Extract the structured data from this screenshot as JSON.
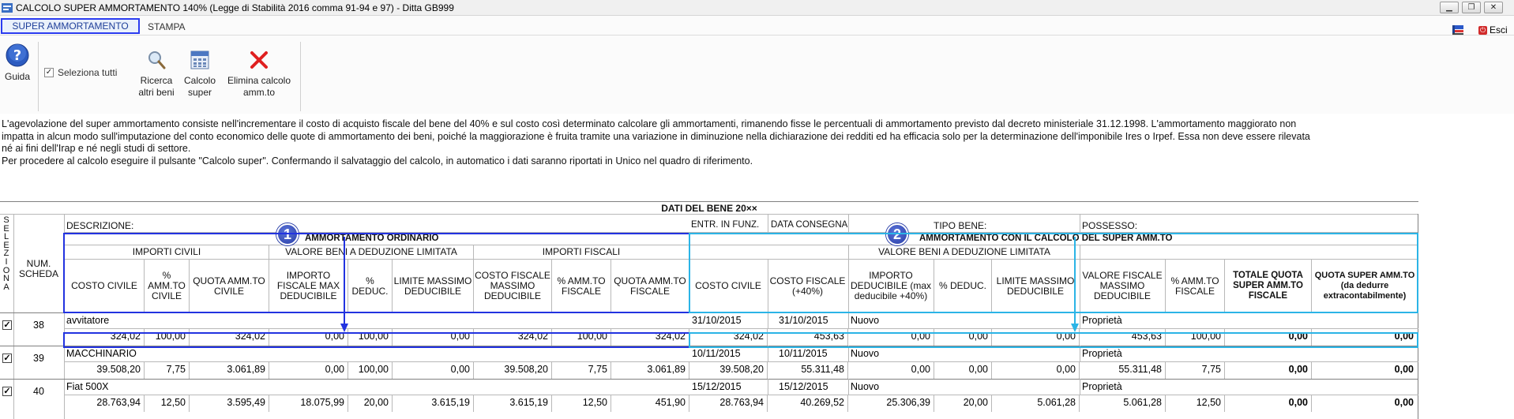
{
  "window": {
    "title": "CALCOLO SUPER AMMORTAMENTO 140% (Legge di Stabilità 2016 comma 91-94 e 97) - Ditta GB999"
  },
  "tabs": {
    "super": "SUPER AMMORTAMENTO",
    "stampa": "STAMPA",
    "esci": "Esci"
  },
  "toolbar": {
    "guida": "Guida",
    "seleziona_tutti": "Seleziona tutti",
    "ricerca_l1": "Ricerca",
    "ricerca_l2": "altri beni",
    "calcolo_l1": "Calcolo",
    "calcolo_l2": "super",
    "elimina_l1": "Elimina calcolo",
    "elimina_l2": "amm.to"
  },
  "description": {
    "line1": "L'agevolazione del super ammortamento consiste nell'incrementare il costo di acquisto fiscale del bene del 40% e sul costo così determinato calcolare gli ammortamenti, rimanendo fisse le percentuali di ammortamento previsto dal decreto ministeriale 31.12.1998. L'ammortamento maggiorato non",
    "line2": "impatta in alcun modo sull'imputazione del conto economico delle quote di ammortamento dei beni, poiché la maggiorazione è fruita tramite una variazione in diminuzione nella dichiarazione dei redditi ed ha efficacia solo per la determinazione dell'imponibile Ires o Irpef. Essa non deve essere rilevata",
    "line3": "né ai fini dell'Irap e né negli studi di settore.",
    "line4": "Per procedere al calcolo eseguire il pulsante \"Calcolo super\". Confermando il salvataggio del calcolo, in automatico i dati saranno riportati in Unico nel quadro di riferimento."
  },
  "grid": {
    "title": "DATI DEL BENE 20××",
    "seleziona": "S E L E Z I O N A",
    "num_scheda": "NUM. SCHEDA",
    "descrizione": "DESCRIZIONE:",
    "entr_in_funz": "ENTR. IN FUNZ.",
    "data_consegna": "DATA CONSEGNA",
    "tipo_bene": "TIPO BENE:",
    "possesso": "POSSESSO:",
    "amm_ordinario": "AMMORTAMENTO ORDINARIO",
    "amm_super": "AMMORTAMENTO CON IL CALCOLO DEL SUPER AMM.TO",
    "importi_civili": "IMPORTI CIVILI",
    "valore_beni": "VALORE BENI A DEDUZIONE LIMITATA",
    "importi_fiscali": "IMPORTI FISCALI",
    "valore_beni_2": "VALORE BENI A DEDUZIONE LIMITATA",
    "badge1": "1",
    "badge2": "2",
    "cols": {
      "costo_civile": "COSTO CIVILE",
      "amm_civile": "% AMM.TO CIVILE",
      "quota_civile": "QUOTA AMM.TO CIVILE",
      "importo_fiscale_max": "IMPORTO FISCALE MAX DEDUCIBILE",
      "perc_deduc": "% DEDUC.",
      "limite_max": "LIMITE MASSIMO DEDUCIBILE",
      "costo_fiscale_max": "COSTO FISCALE MASSIMO DEDUCIBILE",
      "amm_fiscale": "% AMM.TO FISCALE",
      "quota_fiscale": "QUOTA AMM.TO FISCALE",
      "costo_civile_2": "COSTO CIVILE",
      "costo_fiscale_40": "COSTO FISCALE (+40%)",
      "importo_deducibile": "IMPORTO DEDUCIBILE (max deducibile +40%)",
      "perc_deduc_2": "% DEDUC.",
      "limite_max_2": "LIMITE MASSIMO DEDUCIBILE",
      "valore_fiscale_max": "VALORE FISCALE MASSIMO DEDUCIBILE",
      "amm_fiscale_2": "% AMM.TO FISCALE",
      "totale_quota": "TOTALE QUOTA SUPER AMM.TO FISCALE",
      "quota_super": "QUOTA SUPER AMM.TO (da dedurre extracontabilmente)"
    },
    "rows": [
      {
        "checked": "✓",
        "num": "38",
        "descrizione": "avvitatore",
        "entr": "31/10/2015",
        "consegna": "31/10/2015",
        "tipo": "Nuovo",
        "possesso": "Proprietà",
        "v": [
          "324,02",
          "100,00",
          "324,02",
          "0,00",
          "100,00",
          "0,00",
          "324,02",
          "100,00",
          "324,02",
          "324,02",
          "453,63",
          "0,00",
          "0,00",
          "0,00",
          "453,63",
          "100,00",
          "0,00",
          "0,00"
        ]
      },
      {
        "checked": "✓",
        "num": "39",
        "descrizione": "MACCHINARIO",
        "entr": "10/11/2015",
        "consegna": "10/11/2015",
        "tipo": "Nuovo",
        "possesso": "Proprietà",
        "v": [
          "39.508,20",
          "7,75",
          "3.061,89",
          "0,00",
          "100,00",
          "0,00",
          "39.508,20",
          "7,75",
          "3.061,89",
          "39.508,20",
          "55.311,48",
          "0,00",
          "0,00",
          "0,00",
          "55.311,48",
          "7,75",
          "0,00",
          "0,00"
        ]
      },
      {
        "checked": "✓",
        "num": "40",
        "descrizione": "Fiat 500X",
        "entr": "15/12/2015",
        "consegna": "15/12/2015",
        "tipo": "Nuovo",
        "possesso": "Proprietà",
        "v": [
          "28.763,94",
          "12,50",
          "3.595,49",
          "18.075,99",
          "20,00",
          "3.615,19",
          "3.615,19",
          "12,50",
          "451,90",
          "28.763,94",
          "40.269,52",
          "25.306,39",
          "20,00",
          "5.061,28",
          "5.061,28",
          "12,50",
          "0,00",
          "0,00"
        ]
      }
    ]
  }
}
